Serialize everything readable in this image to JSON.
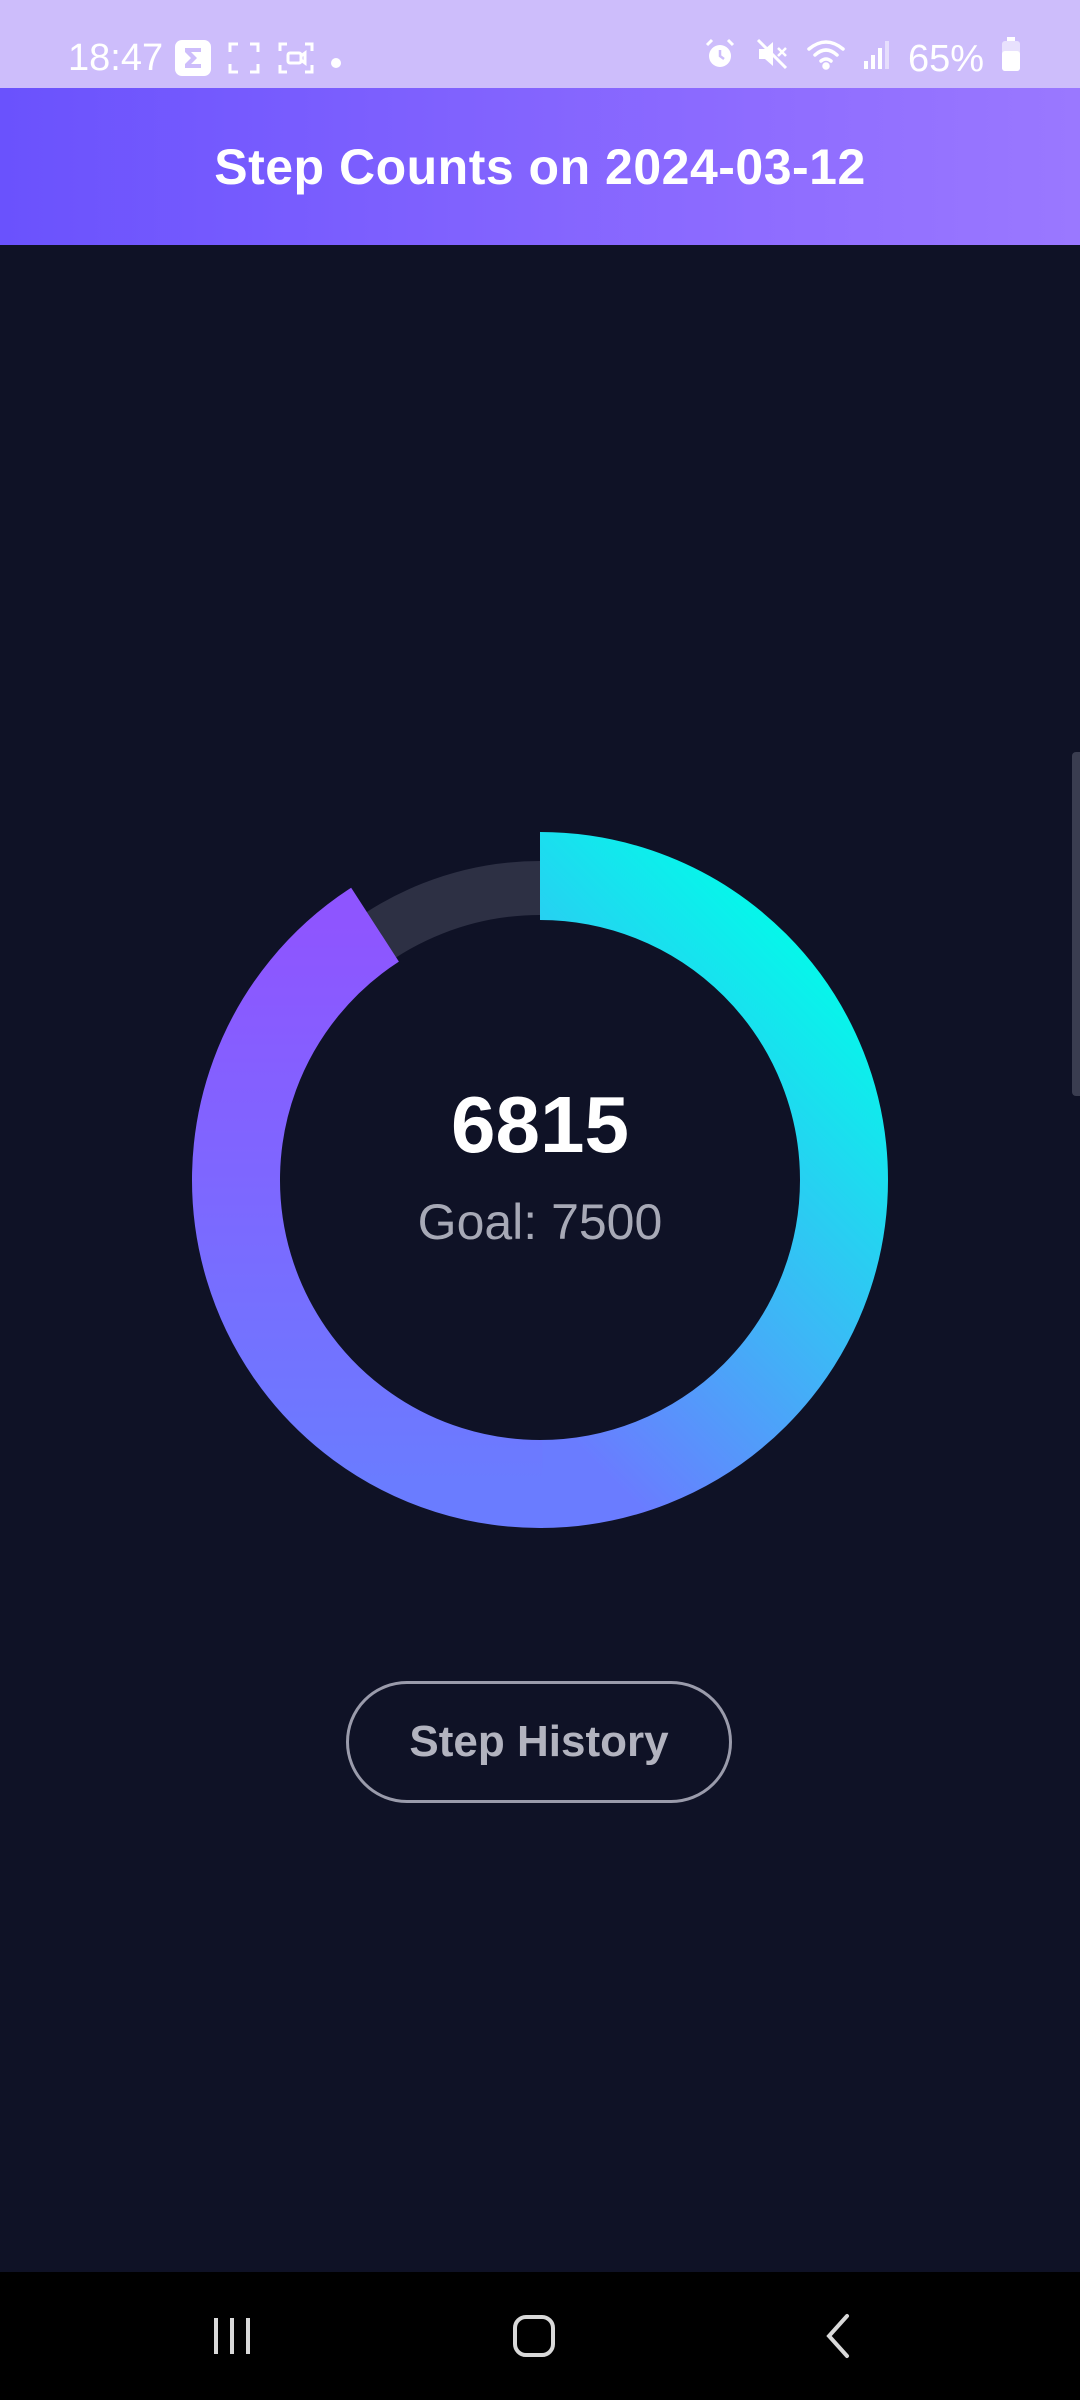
{
  "status_bar": {
    "time": "18:47",
    "battery_text": "65%",
    "icons_left": [
      "sigma-app-icon",
      "screenshot-frame-icon",
      "screen-record-icon",
      "notification-dot-icon"
    ],
    "icons_right": [
      "alarm-icon",
      "mute-icon",
      "wifi-icon",
      "signal-icon",
      "battery-icon"
    ]
  },
  "header": {
    "title": "Step Counts on 2024-03-12"
  },
  "progress": {
    "steps": 6815,
    "steps_text": "6815",
    "goal": 7500,
    "goal_text": "Goal: 7500",
    "fraction": 0.9087
  },
  "actions": {
    "history_label": "Step History"
  },
  "colors": {
    "background": "#0f1226",
    "header_start": "#6a52fd",
    "header_end": "#9a78ff",
    "ring_start": "#00fde9",
    "ring_mid": "#3cb8f6",
    "ring_end": "#8e55ff",
    "ring_track": "#2d3044"
  },
  "nav": {
    "buttons": [
      "recent-apps-icon",
      "home-icon",
      "back-icon"
    ]
  }
}
